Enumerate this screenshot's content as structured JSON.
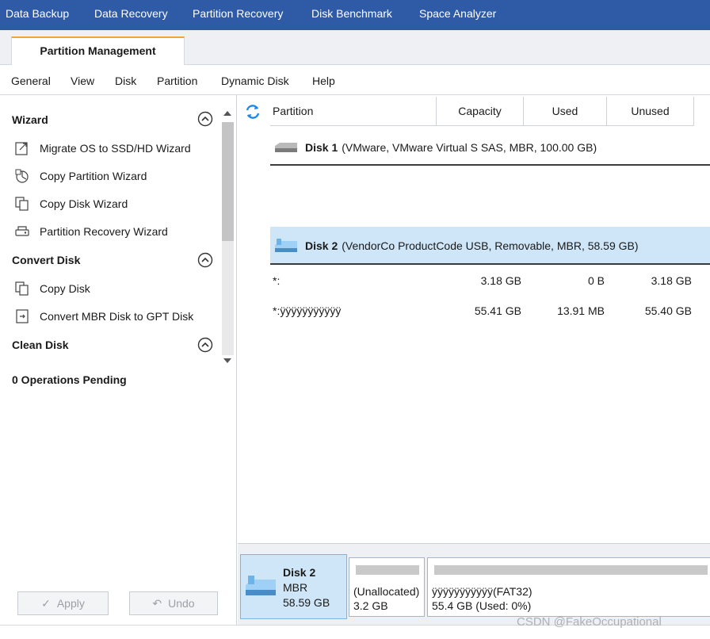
{
  "topnav": [
    "Data Backup",
    "Data Recovery",
    "Partition Recovery",
    "Disk Benchmark",
    "Space Analyzer"
  ],
  "tab": {
    "label": "Partition Management"
  },
  "menu": [
    "General",
    "View",
    "Disk",
    "Partition",
    "Dynamic Disk",
    "Help"
  ],
  "left": {
    "wizard": {
      "heading": "Wizard",
      "items": [
        "Migrate OS to SSD/HD Wizard",
        "Copy Partition Wizard",
        "Copy Disk Wizard",
        "Partition Recovery Wizard"
      ]
    },
    "convert": {
      "heading": "Convert Disk",
      "items": [
        "Copy Disk",
        "Convert MBR Disk to GPT Disk"
      ]
    },
    "clean": {
      "heading": "Clean Disk"
    },
    "pending": "0 Operations Pending",
    "apply": "Apply",
    "undo": "Undo"
  },
  "table": {
    "columns": [
      "Partition",
      "Capacity",
      "Used",
      "Unused"
    ],
    "disk1": {
      "name": "Disk 1",
      "desc": "(VMware, VMware Virtual S SAS, MBR, 100.00 GB)"
    },
    "disk2": {
      "name": "Disk 2",
      "desc": "(VendorCo ProductCode USB, Removable, MBR, 58.59 GB)"
    },
    "rows": [
      {
        "partition": "*:",
        "capacity": "3.18 GB",
        "used": "0 B",
        "unused": "3.18 GB"
      },
      {
        "partition": "*:ÿÿÿÿÿÿÿÿÿÿÿ",
        "capacity": "55.41 GB",
        "used": "13.91 MB",
        "unused": "55.40 GB"
      }
    ]
  },
  "diskmap": {
    "disk": {
      "name": "Disk 2",
      "type": "MBR",
      "size": "58.59 GB"
    },
    "parts": [
      {
        "line1": "(Unallocated)",
        "line2": "3.2 GB"
      },
      {
        "line1": "ÿÿÿÿÿÿÿÿÿÿÿ(FAT32)",
        "line2": "55.4 GB (Used: 0%)"
      }
    ]
  },
  "watermark": "CSDN @FakeOccupational",
  "colors": {
    "topbar": "#2f5aa6",
    "selection": "#cfe6f8",
    "tab_accent": "#f0a43c",
    "refresh": "#1e88e5"
  }
}
